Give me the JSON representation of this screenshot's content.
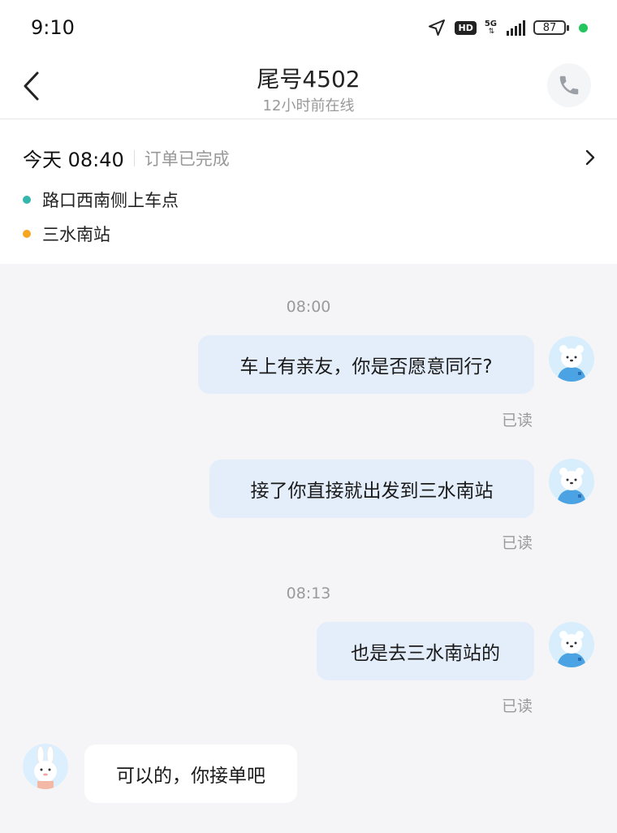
{
  "status_bar": {
    "time": "9:10",
    "hd": "HD",
    "network": "5G",
    "battery": "87"
  },
  "header": {
    "title": "尾号4502",
    "subtitle": "12小时前在线"
  },
  "order": {
    "date": "今天 08:40",
    "status": "订单已完成",
    "pickup": "路口西南侧上车点",
    "dropoff": "三水南站",
    "pickup_color": "#35b6ac",
    "dropoff_color": "#f5a623"
  },
  "chat": {
    "timestamps": [
      "08:00",
      "08:13"
    ],
    "messages": [
      {
        "text": "车上有亲友，你是否愿意同行?",
        "status": "已读"
      },
      {
        "text": "接了你直接就出发到三水南站",
        "status": "已读"
      },
      {
        "text": "也是去三水南站的",
        "status": "已读"
      },
      {
        "text": "可以的，你接单吧"
      }
    ]
  },
  "colors": {
    "outgoing_bubble": "#e4eefb",
    "incoming_bubble": "#ffffff",
    "background": "#f5f5f7"
  }
}
